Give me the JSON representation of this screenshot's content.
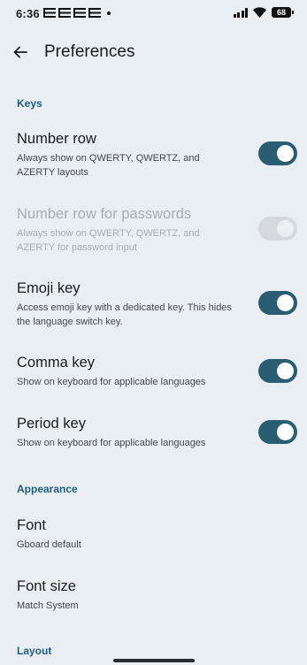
{
  "status_bar": {
    "time": "6:36",
    "notification_icons": [
      "e-icon",
      "e-icon",
      "e-icon",
      "e-icon",
      "dot-icon"
    ],
    "battery_level": "68",
    "icons": [
      "signal-icon",
      "wifi-icon",
      "battery-icon"
    ]
  },
  "app_bar": {
    "title": "Preferences",
    "back_icon": "arrow-back-icon"
  },
  "sections": {
    "keys": {
      "header": "Keys"
    },
    "appearance": {
      "header": "Appearance"
    },
    "layout": {
      "header": "Layout"
    }
  },
  "prefs": {
    "number_row": {
      "title": "Number row",
      "summary": "Always show on QWERTY, QWERTZ, and AZERTY layouts",
      "enabled": true,
      "checked": true
    },
    "number_row_passwords": {
      "title": "Number row for passwords",
      "summary": "Always show on QWERTY, QWERTZ, and AZERTY for password input",
      "enabled": false,
      "checked": false
    },
    "emoji_key": {
      "title": "Emoji key",
      "summary": "Access emoji key with a dedicated key. This hides the language switch key.",
      "enabled": true,
      "checked": true
    },
    "comma_key": {
      "title": "Comma key",
      "summary": "Show on keyboard for applicable languages",
      "enabled": true,
      "checked": true
    },
    "period_key": {
      "title": "Period key",
      "summary": "Show on keyboard for applicable languages",
      "enabled": true,
      "checked": true
    },
    "font": {
      "title": "Font",
      "summary": "Gboard default"
    },
    "font_size": {
      "title": "Font size",
      "summary": "Match System"
    }
  },
  "colors": {
    "background": "#e9eef3",
    "accent": "#2a5c72",
    "section_header": "#1e5f7b",
    "disabled_text": "#a9adb2"
  }
}
